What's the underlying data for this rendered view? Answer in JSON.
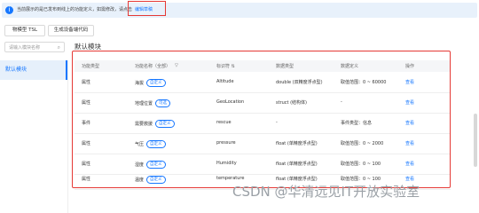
{
  "notice": {
    "text": "当前展示的是已发布到线上的功能定义，如需修改，请点击",
    "link": "编辑草稿"
  },
  "toolbar": {
    "view_tsl": "物模型 TSL",
    "gen_code": "生成设备端代码"
  },
  "sidebar": {
    "search_placeholder": "请输入模块名称",
    "items": [
      {
        "label": "默认模块"
      }
    ]
  },
  "module_title": "默认模块",
  "table": {
    "headers": [
      "功能类型",
      "功能名称（全部）",
      "标识符 ⇅",
      "数据类型",
      "数据定义",
      "操作"
    ],
    "rows": [
      {
        "type": "属性",
        "name": "海拔",
        "tag": "自定义",
        "id": "Altitude",
        "dtype": "double (双精度浮点型)",
        "def": "取值范围：0 ~ 60000",
        "op": "查看"
      },
      {
        "type": "属性",
        "name": "地理位置",
        "tag": "可选",
        "id": "GeoLocation",
        "dtype": "struct (结构体)",
        "def": "-",
        "op": "查看"
      },
      {
        "type": "事件",
        "name": "需要救援",
        "tag": "自定义",
        "id": "rescue",
        "dtype": "-",
        "def": "事件类型：信息",
        "op": "查看"
      },
      {
        "type": "属性",
        "name": "气压",
        "tag": "自定义",
        "id": "pressure",
        "dtype": "float (单精度浮点型)",
        "def": "取值范围：0 ~ 2000",
        "op": "查看"
      },
      {
        "type": "属性",
        "name": "湿度",
        "tag": "自定义",
        "id": "Humidity",
        "dtype": "float (单精度浮点型)",
        "def": "取值范围：0 ~ 100",
        "op": "查看"
      },
      {
        "type": "属性",
        "name": "温度",
        "tag": "自定义",
        "id": "temperature",
        "dtype": "float (单精度浮点型)",
        "def": "取值范围：0 ~ 100",
        "op": "查看"
      }
    ]
  },
  "watermark": "CSDN @华清远见IT开放实验室"
}
